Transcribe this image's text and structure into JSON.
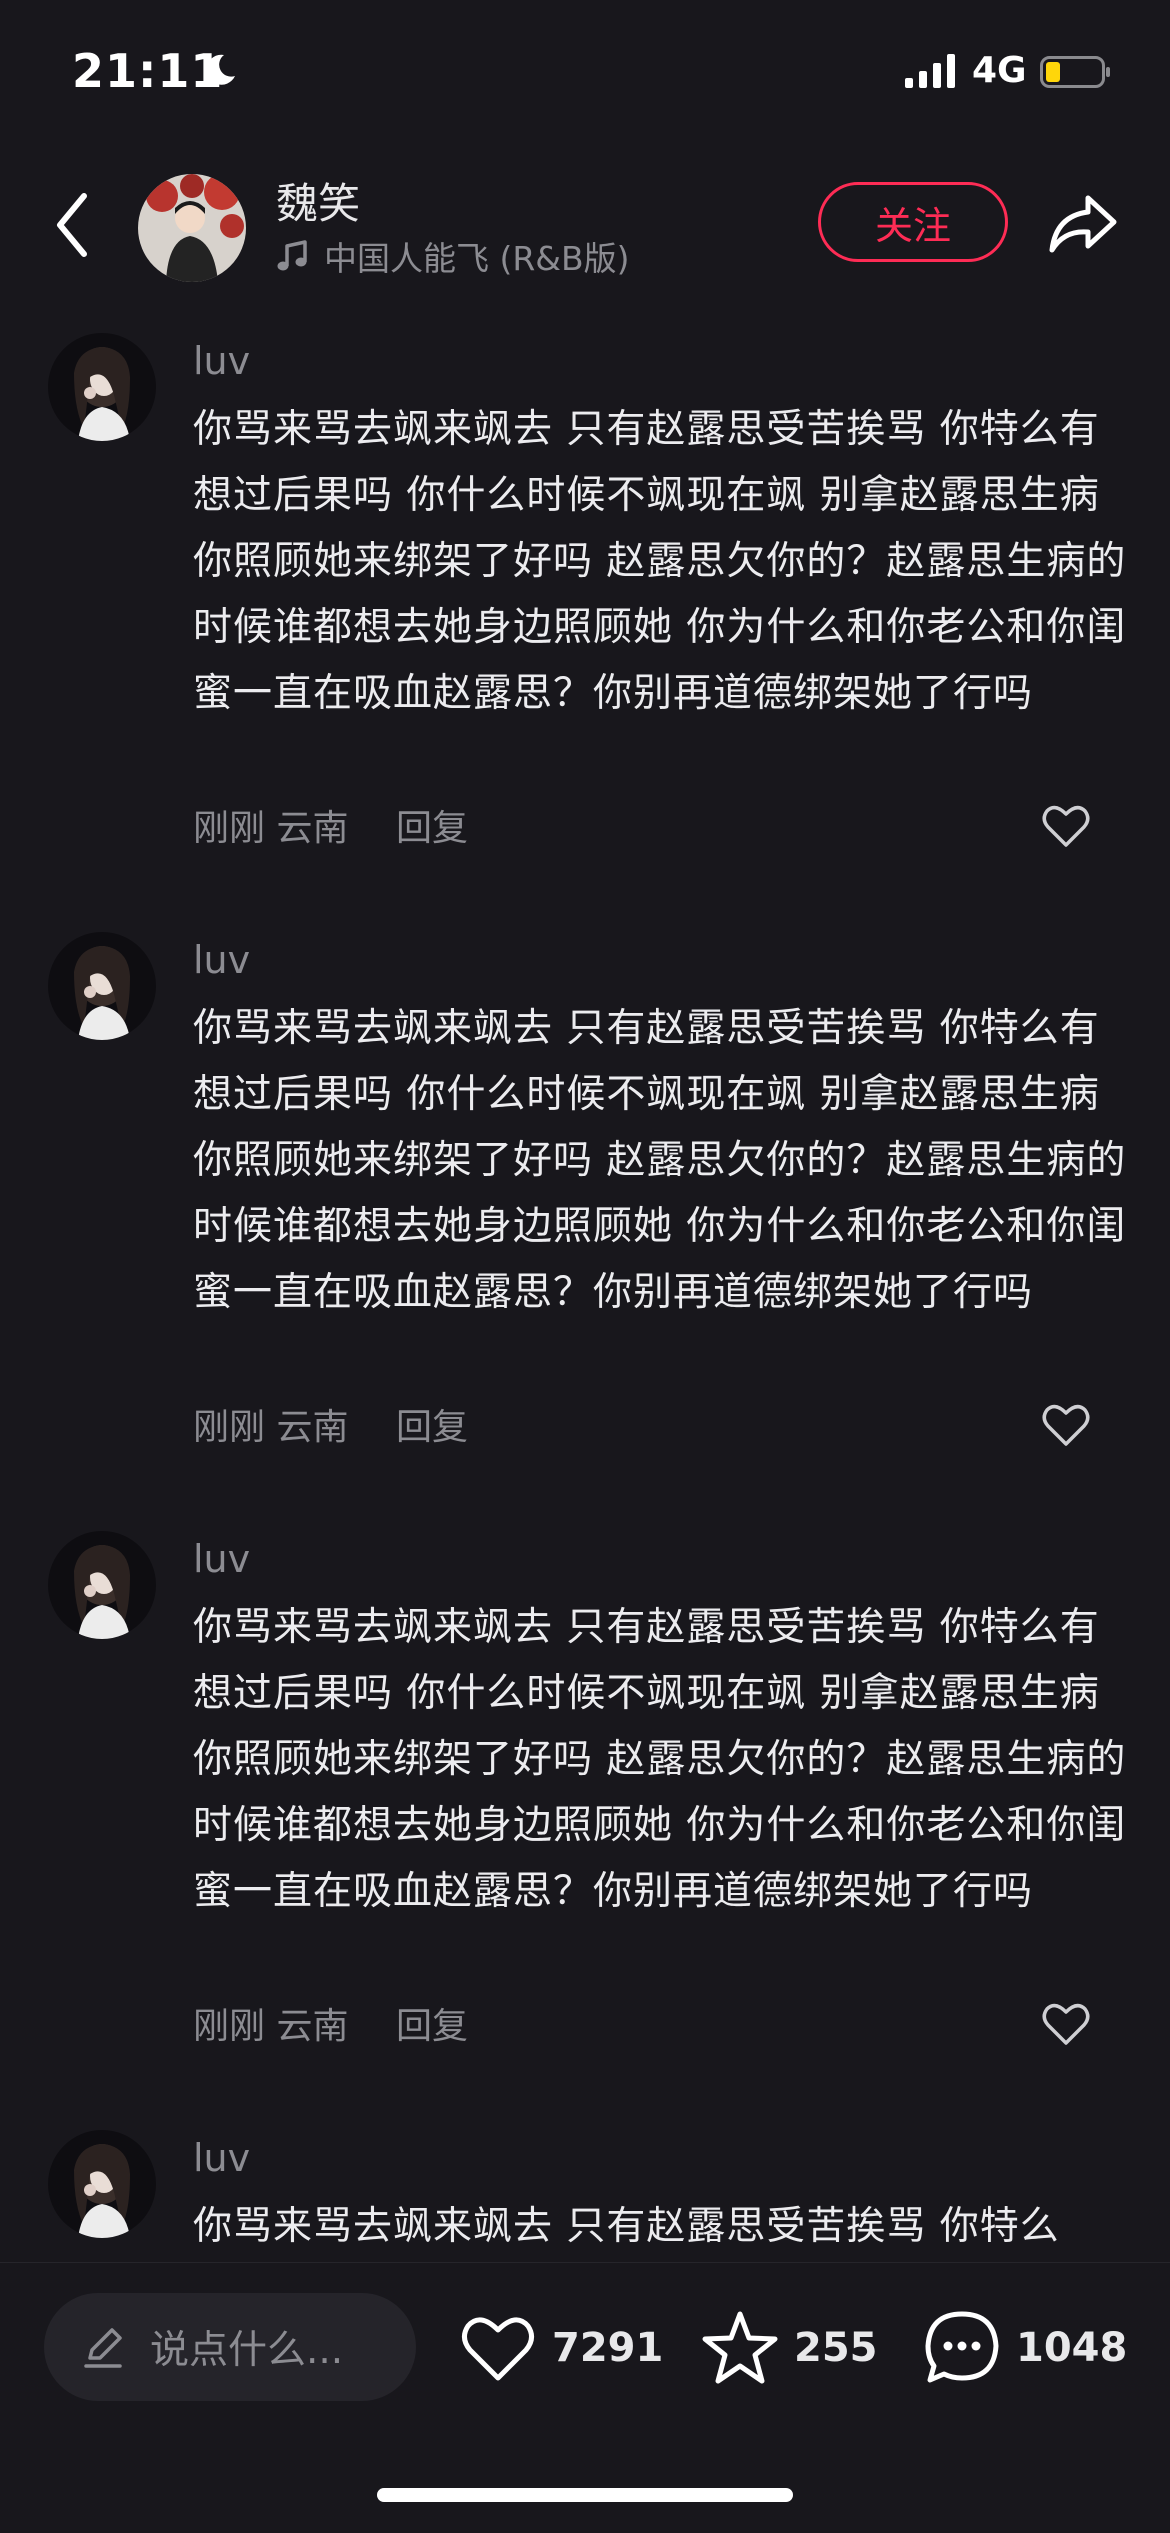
{
  "status_bar": {
    "time": "21:11",
    "network": "4G"
  },
  "header": {
    "author_name": "魏笑",
    "music_title": "中国人能飞 (R&B版)",
    "follow_label": "关注"
  },
  "comments": [
    {
      "username": "luv",
      "text": "你骂来骂去飒来飒去 只有赵露思受苦挨骂 你特么有想过后果吗 你什么时候不飒现在飒 别拿赵露思生病你照顾她来绑架了好吗 赵露思欠你的？赵露思生病的时候谁都想去她身边照顾她 你为什么和你老公和你闺蜜一直在吸血赵露思？你别再道德绑架她了行吗",
      "time": "刚刚",
      "location": "云南",
      "reply_label": "回复"
    },
    {
      "username": "luv",
      "text": "你骂来骂去飒来飒去 只有赵露思受苦挨骂 你特么有想过后果吗 你什么时候不飒现在飒 别拿赵露思生病你照顾她来绑架了好吗 赵露思欠你的？赵露思生病的时候谁都想去她身边照顾她 你为什么和你老公和你闺蜜一直在吸血赵露思？你别再道德绑架她了行吗",
      "time": "刚刚",
      "location": "云南",
      "reply_label": "回复"
    },
    {
      "username": "luv",
      "text": "你骂来骂去飒来飒去 只有赵露思受苦挨骂 你特么有想过后果吗 你什么时候不飒现在飒 别拿赵露思生病你照顾她来绑架了好吗 赵露思欠你的？赵露思生病的时候谁都想去她身边照顾她 你为什么和你老公和你闺蜜一直在吸血赵露思？你别再道德绑架她了行吗",
      "time": "刚刚",
      "location": "云南",
      "reply_label": "回复"
    },
    {
      "username": "luv",
      "text": "你骂来骂去飒来飒去 只有赵露思受苦挨骂 你特么"
    }
  ],
  "bottom_bar": {
    "input_placeholder": "说点什么...",
    "likes": "7291",
    "favorites": "255",
    "comments": "1048"
  },
  "colors": {
    "background": "#18171c",
    "accent": "#fe2c55",
    "muted": "#8c8c92"
  }
}
